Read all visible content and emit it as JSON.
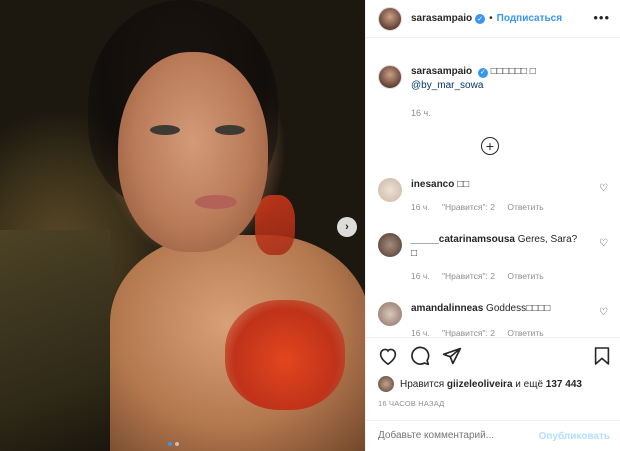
{
  "post": {
    "author": "sarasampaio",
    "follow_label": "Подписаться",
    "separator": "•",
    "more_glyph": "•••"
  },
  "caption": {
    "username": "sarasampaio",
    "text": "□□□□□□ □",
    "mention": "@by_mar_sowa",
    "time": "16 ч."
  },
  "add_glyph": "+",
  "comments": [
    {
      "username": "inesanco",
      "text": "□□",
      "time": "16 ч.",
      "likes": "\"Нравится\": 2",
      "reply": "Ответить"
    },
    {
      "username": "_____catarinamsousa",
      "text": "Geres, Sara? □",
      "time": "16 ч.",
      "likes": "\"Нравится\": 2",
      "reply": "Ответить"
    },
    {
      "username": "amandalinneas",
      "text": "Goddess□□□□",
      "time": "16 ч.",
      "likes": "\"Нравится\": 2",
      "reply": "Ответить"
    }
  ],
  "likes": {
    "prefix": "Нравится",
    "user": "giizeleoliveira",
    "and_more": "и ещё",
    "count": "137 443"
  },
  "post_time": "16 ЧАСОВ НАЗАД",
  "comment_box": {
    "placeholder": "Добавьте комментарий...",
    "publish_label": "Опубликовать"
  },
  "carousel": {
    "slide_count": 2,
    "active_slide": 1,
    "next_glyph": "›"
  },
  "colors": {
    "accent": "#3897f0",
    "publish_disabled": "#b2dffc",
    "muted": "#8e8e8e"
  }
}
